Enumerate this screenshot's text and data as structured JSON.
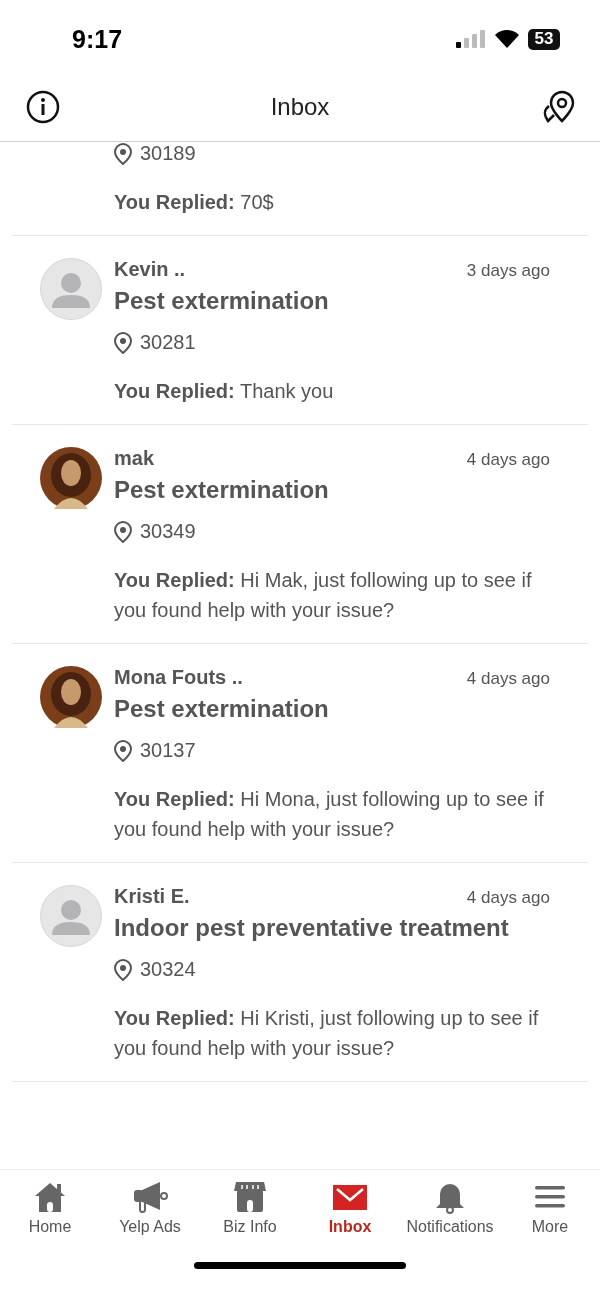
{
  "status_bar": {
    "time": "9:17",
    "battery": "53"
  },
  "header": {
    "title": "Inbox"
  },
  "messages": [
    {
      "location": "30189",
      "reply_label": "You Replied:",
      "reply": "70$"
    },
    {
      "avatar": {
        "kind": "default"
      },
      "name": "Kevin ..",
      "time": "3 days ago",
      "title": "Pest extermination",
      "location": "30281",
      "reply_label": "You Replied:",
      "reply": "Thank you"
    },
    {
      "name": "mak",
      "time": "4 days ago",
      "title": "Pest extermination",
      "location": "30349",
      "reply_label": "You Replied:",
      "reply": "Hi Mak, just following up to see if you found help with your issue?"
    },
    {
      "name": "Mona Fouts ..",
      "time": "4 days ago",
      "title": "Pest extermination",
      "location": "30137",
      "reply_label": "You Replied:",
      "reply": "Hi Mona, just following up to see if you found help with your issue?"
    },
    {
      "avatar": {
        "kind": "default"
      },
      "name": "Kristi E.",
      "time": "4 days ago",
      "title": "Indoor pest preventative treatment",
      "location": "30324",
      "reply_label": "You Replied:",
      "reply": "Hi Kristi, just following up to see if you found help with your issue?"
    }
  ],
  "tab_bar": [
    {
      "kind": "home",
      "label": "Home",
      "selected": false
    },
    {
      "kind": "ads",
      "label": "Yelp Ads",
      "selected": false
    },
    {
      "kind": "biz",
      "label": "Biz Info",
      "selected": false
    },
    {
      "kind": "inbox",
      "label": "Inbox",
      "selected": true
    },
    {
      "kind": "bell",
      "label": "Notifications",
      "selected": false
    },
    {
      "kind": "more",
      "label": "More",
      "selected": false
    }
  ]
}
